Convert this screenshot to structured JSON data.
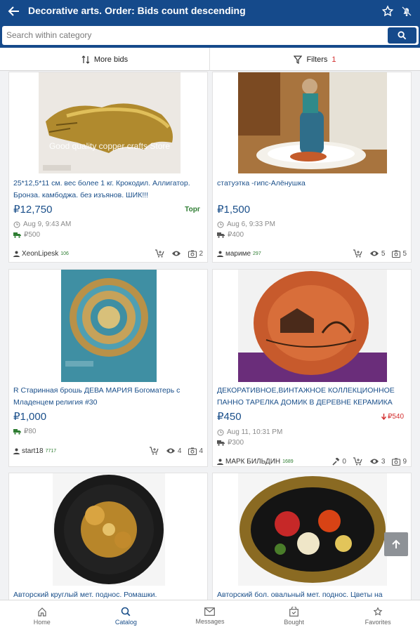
{
  "header": {
    "title": "Decorative arts. Order: Bids count descending",
    "search_placeholder": "Search within category"
  },
  "toolbar": {
    "sort_label": "More bids",
    "filters_label": "Filters",
    "filters_count": "1"
  },
  "items": [
    {
      "title": "25*12,5*11 см. вес более 1 кг. Крокодил. Аллигатор. Бронза. камбоджа. без изъянов. ШИК!!!",
      "watermark": "Good quality copper crafts Store",
      "price": "₽12,750",
      "price_note": "Торг",
      "date": "Aug 9, 9:43 AM",
      "shipping": "₽500",
      "seller": "XeonLipesk",
      "seller_rating": "106",
      "views": "",
      "photos": "2"
    },
    {
      "title": "статуэтка -гипс-Алёнушка",
      "price": "₽1,500",
      "date": "Aug 6, 9:33 PM",
      "shipping": "₽400",
      "seller": "мариме",
      "seller_rating": "297",
      "views": "5",
      "photos": "5"
    },
    {
      "title": "R Старинная брошь ДЕВА МАРИЯ Богоматерь с Младенцем религия #30",
      "price": "₽1,000",
      "shipping": "₽80",
      "seller": "start18",
      "seller_rating": "7717",
      "views": "4",
      "photos": "4"
    },
    {
      "title": "ДЕКОРАТИВНОЕ,ВИНТАЖНОЕ КОЛЛЕКЦИОННОЕ ПАННО ТАРЕЛКА ДОМИК В ДЕРЕВНЕ КЕРАМИКА",
      "price": "₽450",
      "old_price": "₽540",
      "date": "Aug 11, 10:31 PM",
      "shipping": "₽300",
      "seller": "МАРК БИЛЬДИН",
      "seller_rating": "1689",
      "bids": "0",
      "views": "3",
      "photos": "9"
    },
    {
      "title": "Авторский круглый мет. поднос. Ромашки."
    },
    {
      "title": "Авторский бол. овальный мет. поднос. Цветы на"
    }
  ],
  "bottom_nav": {
    "home": "Home",
    "catalog": "Catalog",
    "messages": "Messages",
    "bought": "Bought",
    "favorites": "Favorites"
  },
  "colors": {
    "brand": "#154a8b",
    "link": "#1a4f8a",
    "negotiable": "#2e7d32",
    "discount": "#d32f2f"
  }
}
